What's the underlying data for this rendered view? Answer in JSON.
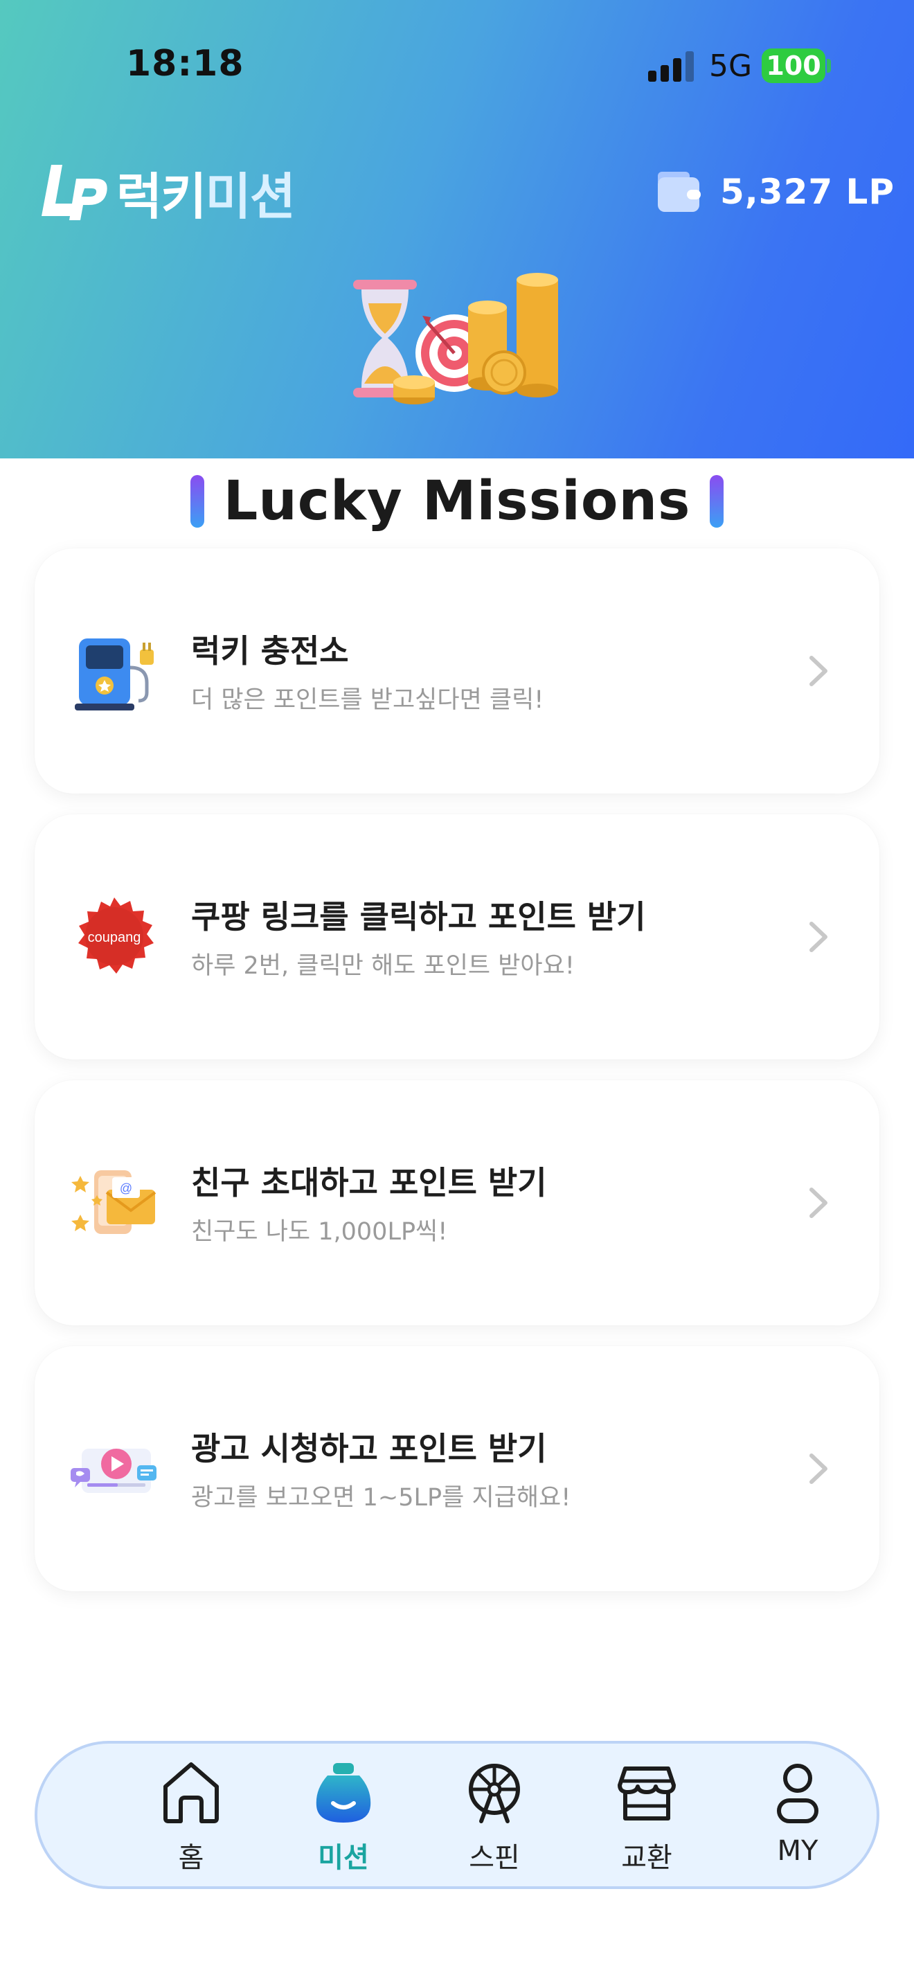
{
  "status_bar": {
    "time": "18:18",
    "network": "5G",
    "battery": "100"
  },
  "header": {
    "brand_logo_text": "LP",
    "brand_name_main": "럭키",
    "brand_name_accent": "미션",
    "wallet_amount": "5,327 LP"
  },
  "section": {
    "title": "Lucky Missions"
  },
  "missions": [
    {
      "title": "럭키 충전소",
      "subtitle": "더 많은 포인트를 받고싶다면 클릭!",
      "icon": "charging-station-icon"
    },
    {
      "title": "쿠팡 링크를 클릭하고 포인트 받기",
      "subtitle": "하루 2번, 클릭만 해도 포인트 받아요!",
      "icon": "coupang-badge-icon",
      "badge_text": "coupang"
    },
    {
      "title": "친구 초대하고 포인트 받기",
      "subtitle": "친구도 나도 1,000LP씩!",
      "icon": "invite-envelope-icon"
    },
    {
      "title": "광고 시청하고 포인트 받기",
      "subtitle": "광고를 보고오면 1~5LP를 지급해요!",
      "icon": "video-ad-icon"
    }
  ],
  "nav": {
    "items": [
      {
        "label": "홈",
        "icon": "home-icon"
      },
      {
        "label": "미션",
        "icon": "mission-bag-icon",
        "active": true
      },
      {
        "label": "스핀",
        "icon": "ferris-wheel-icon"
      },
      {
        "label": "교환",
        "icon": "store-icon"
      },
      {
        "label": "MY",
        "icon": "user-icon"
      }
    ]
  },
  "colors": {
    "hero_start": "#55c9bf",
    "hero_end": "#346af8",
    "active_nav": "#1aa4a0",
    "battery": "#2ecc40"
  }
}
